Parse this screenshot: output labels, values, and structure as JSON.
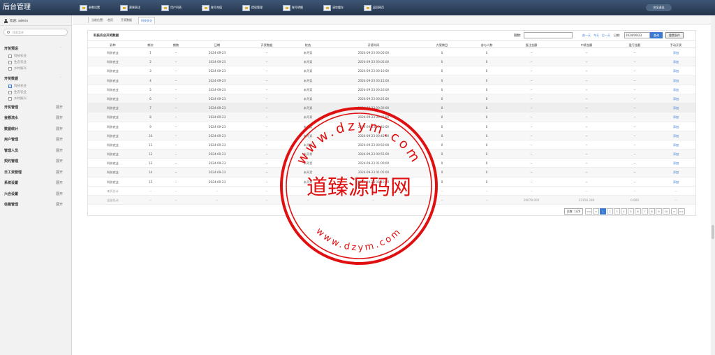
{
  "brand": "后台管理",
  "top_nav": [
    {
      "label": "参数设置",
      "icon": "settings-icon"
    },
    {
      "label": "赛果表注",
      "icon": "record-icon"
    },
    {
      "label": "用户列表",
      "icon": "users-icon"
    },
    {
      "label": "账号充值",
      "icon": "recharge-icon"
    },
    {
      "label": "提现管理",
      "icon": "withdraw-icon"
    },
    {
      "label": "账号明细",
      "icon": "account-icon"
    },
    {
      "label": "清空缓存",
      "icon": "cache-icon"
    },
    {
      "label": "返回网页",
      "icon": "home-icon"
    }
  ],
  "logout_label": "安全退出",
  "sidebar": {
    "welcome": "欢迎: admin",
    "search_placeholder": "搜索菜单",
    "sections": [
      {
        "title": "开奖预设",
        "toggle": "-",
        "items": [
          "科技农业",
          "生态农业",
          "乡村振兴"
        ]
      },
      {
        "title": "开奖数据",
        "toggle": "-",
        "items": [
          "科技农业",
          "生态农业",
          "乡村振兴"
        ]
      }
    ],
    "groups": [
      {
        "label": "开奖管理",
        "toggle": "展开"
      },
      {
        "label": "金额流水",
        "toggle": "展开"
      },
      {
        "label": "数据统计",
        "toggle": "展开"
      },
      {
        "label": "用户管理",
        "toggle": "展开"
      },
      {
        "label": "管理人员",
        "toggle": "展开"
      },
      {
        "label": "契约管理",
        "toggle": "展开"
      },
      {
        "label": "日工资管理",
        "toggle": "展开"
      },
      {
        "label": "系统设置",
        "toggle": "展开"
      },
      {
        "label": "六合设置",
        "toggle": "展开"
      },
      {
        "label": "信箱管理",
        "toggle": "展开"
      }
    ]
  },
  "breadcrumb": {
    "prefix": "当前位置:",
    "home": "首页",
    "level1": "开奖数据",
    "current": "科技农业"
  },
  "panel": {
    "title": "科技农业开奖数据",
    "query_label": "期数:",
    "quick_links": [
      "前一天",
      "今天",
      "后一天"
    ],
    "date_label": "日期:",
    "date_value": "2024/09/23",
    "query_button": "查询",
    "reset_button": "重置条件"
  },
  "table": {
    "headers": [
      "彩种",
      "期次",
      "期数",
      "日期",
      "开奖数据",
      "状态",
      "开奖时间",
      "方案数目",
      "参与人数",
      "投注金额",
      "中奖金额",
      "盈亏金额",
      "手动开奖"
    ],
    "rows": [
      [
        "科技农业",
        "1",
        "--",
        "2024-09-23",
        "--",
        "未开奖",
        "2024-09-23 00:00:00",
        "0",
        "0",
        "--",
        "--",
        "--",
        "添加"
      ],
      [
        "科技农业",
        "2",
        "--",
        "2024-09-23",
        "--",
        "未开奖",
        "2024-09-23 00:05:00",
        "0",
        "0",
        "--",
        "--",
        "--",
        "添加"
      ],
      [
        "科技农业",
        "3",
        "--",
        "2024-09-23",
        "--",
        "未开奖",
        "2024-09-23 00:10:00",
        "0",
        "0",
        "--",
        "--",
        "--",
        "添加"
      ],
      [
        "科技农业",
        "4",
        "--",
        "2024-09-23",
        "--",
        "未开奖",
        "2024-09-23 00:15:00",
        "0",
        "0",
        "--",
        "--",
        "--",
        "添加"
      ],
      [
        "科技农业",
        "5",
        "--",
        "2024-09-23",
        "--",
        "未开奖",
        "2024-09-23 00:20:00",
        "0",
        "0",
        "--",
        "--",
        "--",
        "添加"
      ],
      [
        "科技农业",
        "6",
        "--",
        "2024-09-23",
        "--",
        "未开奖",
        "2024-09-23 00:25:00",
        "0",
        "0",
        "--",
        "--",
        "--",
        "添加"
      ],
      [
        "科技农业",
        "7",
        "--",
        "2024-09-23",
        "--",
        "未开奖",
        "2024-09-23 00:30:00",
        "0",
        "0",
        "--",
        "--",
        "--",
        "添加"
      ],
      [
        "科技农业",
        "8",
        "--",
        "2024-09-23",
        "--",
        "未开奖",
        "2024-09-23 00:35:00",
        "0",
        "0",
        "--",
        "--",
        "--",
        "添加"
      ],
      [
        "科技农业",
        "9",
        "--",
        "2024-09-23",
        "--",
        "未开奖",
        "2024-09-23 00:40:00",
        "0",
        "0",
        "--",
        "--",
        "--",
        "添加"
      ],
      [
        "科技农业",
        "10",
        "--",
        "2024-09-23",
        "--",
        "未开奖",
        "2024-09-23 00:45:00",
        "0",
        "0",
        "--",
        "--",
        "--",
        "添加"
      ],
      [
        "科技农业",
        "11",
        "--",
        "2024-09-23",
        "--",
        "未开奖",
        "2024-09-23 00:50:00",
        "0",
        "0",
        "--",
        "--",
        "--",
        "添加"
      ],
      [
        "科技农业",
        "12",
        "--",
        "2024-09-23",
        "--",
        "未开奖",
        "2024-09-23 00:55:00",
        "0",
        "0",
        "--",
        "--",
        "--",
        "添加"
      ],
      [
        "科技农业",
        "13",
        "--",
        "2024-09-23",
        "--",
        "未开奖",
        "2024-09-23 01:00:00",
        "0",
        "0",
        "--",
        "--",
        "--",
        "添加"
      ],
      [
        "科技农业",
        "14",
        "--",
        "2024-09-23",
        "--",
        "未开奖",
        "2024-09-23 01:05:00",
        "0",
        "0",
        "--",
        "--",
        "--",
        "添加"
      ],
      [
        "科技农业",
        "15",
        "--",
        "2024-09-23",
        "--",
        "未开奖",
        "2024-09-23 01:10:00",
        "0",
        "0",
        "--",
        "--",
        "--",
        "添加"
      ]
    ],
    "summary_rows": [
      [
        "本页总计",
        "--",
        "--",
        "--",
        "--",
        "--",
        "--",
        "--",
        "--",
        "--",
        "--",
        "--",
        "--"
      ],
      [
        "全部总计",
        "--",
        "--",
        "--",
        "--",
        "--",
        "--",
        "--",
        "--",
        "29078.000",
        "22156.280",
        "0.000",
        "--"
      ]
    ]
  },
  "pager": {
    "info": "页数: 1/20",
    "first": "<<",
    "prev": "<",
    "pages": [
      "1",
      "2",
      "3",
      "4",
      "5",
      "6",
      "7",
      "8",
      "9",
      "10"
    ],
    "next": ">",
    "last": ">>"
  },
  "watermark": {
    "text": "道臻源码网",
    "domain_top": "www.dzym.com",
    "domain_bottom": "www.dzym.com",
    "color": "#e01010"
  }
}
